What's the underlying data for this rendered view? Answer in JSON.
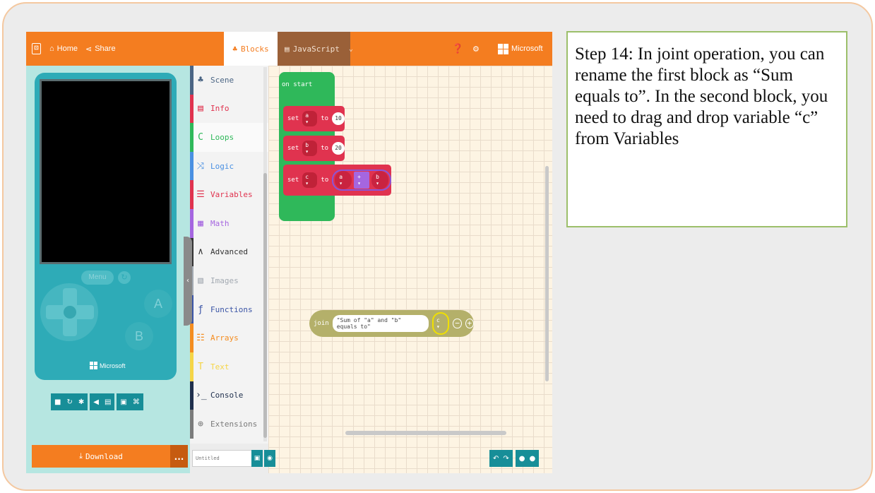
{
  "header": {
    "home_label": "Home",
    "share_label": "Share",
    "tab_blocks": "Blocks",
    "tab_javascript": "JavaScript",
    "brand": "Microsoft"
  },
  "simulator": {
    "menu_label": "Menu",
    "button_a": "A",
    "button_b": "B",
    "device_brand": "Microsoft"
  },
  "toolbox": {
    "categories": [
      {
        "label": "Scene",
        "color": "#4b6584",
        "icon": "tree-icon"
      },
      {
        "label": "Info",
        "color": "#e0334f",
        "icon": "info-card-icon"
      },
      {
        "label": "Loops",
        "color": "#2fb85a",
        "icon": "loop-icon"
      },
      {
        "label": "Logic",
        "color": "#4a90e2",
        "icon": "shuffle-icon"
      },
      {
        "label": "Variables",
        "color": "#e0334f",
        "icon": "list-icon"
      },
      {
        "label": "Math",
        "color": "#a566e0",
        "icon": "calculator-icon"
      },
      {
        "label": "Advanced",
        "color": "#333333",
        "icon": "chevron-up-icon"
      },
      {
        "label": "Images",
        "color": "#a3aab2",
        "icon": "image-icon"
      },
      {
        "label": "Functions",
        "color": "#3b55a6",
        "icon": "function-icon"
      },
      {
        "label": "Arrays",
        "color": "#f48d20",
        "icon": "array-icon"
      },
      {
        "label": "Text",
        "color": "#f5d547",
        "icon": "text-icon"
      },
      {
        "label": "Console",
        "color": "#1f2f4d",
        "icon": "console-icon"
      },
      {
        "label": "Extensions",
        "color": "#7b7b7b",
        "icon": "plus-circle-icon"
      }
    ]
  },
  "blocks": {
    "on_start": "on start",
    "set": "set",
    "to": "to",
    "var_a": "a ▾",
    "var_b": "b ▾",
    "var_c": "c ▾",
    "value_a": "10",
    "value_b": "20",
    "op_plus": "+ ▾",
    "join_label": "join",
    "join_string": "\"Sum of \"a\" and \"b\" equals to\""
  },
  "footer": {
    "download_label": "Download",
    "more_label": "...",
    "project_name_placeholder": "Untitled"
  },
  "caption": {
    "text": "Step 14: In joint operation, you can rename the first block as “Sum equals to”. In the second block, you need to drag and drop variable “c” from Variables"
  }
}
